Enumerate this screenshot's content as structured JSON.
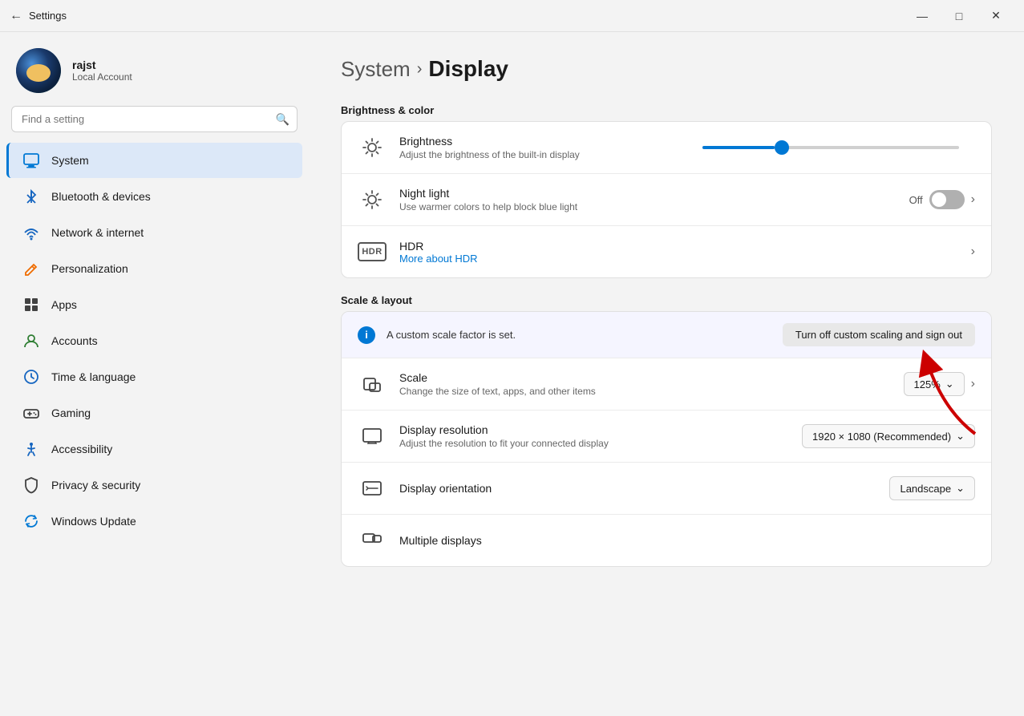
{
  "titleBar": {
    "title": "Settings",
    "minimize": "—",
    "maximize": "□",
    "close": "✕"
  },
  "user": {
    "name": "rajst",
    "accountType": "Local Account"
  },
  "search": {
    "placeholder": "Find a setting"
  },
  "nav": {
    "items": [
      {
        "id": "system",
        "label": "System",
        "active": true
      },
      {
        "id": "bluetooth",
        "label": "Bluetooth & devices",
        "active": false
      },
      {
        "id": "network",
        "label": "Network & internet",
        "active": false
      },
      {
        "id": "personalization",
        "label": "Personalization",
        "active": false
      },
      {
        "id": "apps",
        "label": "Apps",
        "active": false
      },
      {
        "id": "accounts",
        "label": "Accounts",
        "active": false
      },
      {
        "id": "time",
        "label": "Time & language",
        "active": false
      },
      {
        "id": "gaming",
        "label": "Gaming",
        "active": false
      },
      {
        "id": "accessibility",
        "label": "Accessibility",
        "active": false
      },
      {
        "id": "privacy",
        "label": "Privacy & security",
        "active": false
      },
      {
        "id": "update",
        "label": "Windows Update",
        "active": false
      }
    ]
  },
  "breadcrumb": {
    "system": "System",
    "separator": "›",
    "current": "Display"
  },
  "sections": {
    "brightnessColor": {
      "title": "Brightness & color",
      "items": [
        {
          "id": "brightness",
          "title": "Brightness",
          "desc": "Adjust the brightness of the built-in display",
          "sliderValue": 28
        },
        {
          "id": "nightLight",
          "title": "Night light",
          "desc": "Use warmer colors to help block blue light",
          "toggleState": "Off"
        },
        {
          "id": "hdr",
          "title": "HDR",
          "linkLabel": "More about HDR"
        }
      ]
    },
    "scaleLayout": {
      "title": "Scale & layout",
      "banner": {
        "text": "A custom scale factor is set.",
        "buttonLabel": "Turn off custom scaling and sign out"
      },
      "items": [
        {
          "id": "scale",
          "title": "Scale",
          "desc": "Change the size of text, apps, and other items",
          "value": "125%"
        },
        {
          "id": "resolution",
          "title": "Display resolution",
          "desc": "Adjust the resolution to fit your connected display",
          "value": "1920 × 1080 (Recommended)"
        },
        {
          "id": "orientation",
          "title": "Display orientation",
          "value": "Landscape"
        },
        {
          "id": "multipleDisplays",
          "title": "Multiple displays",
          "desc": ""
        }
      ]
    }
  }
}
